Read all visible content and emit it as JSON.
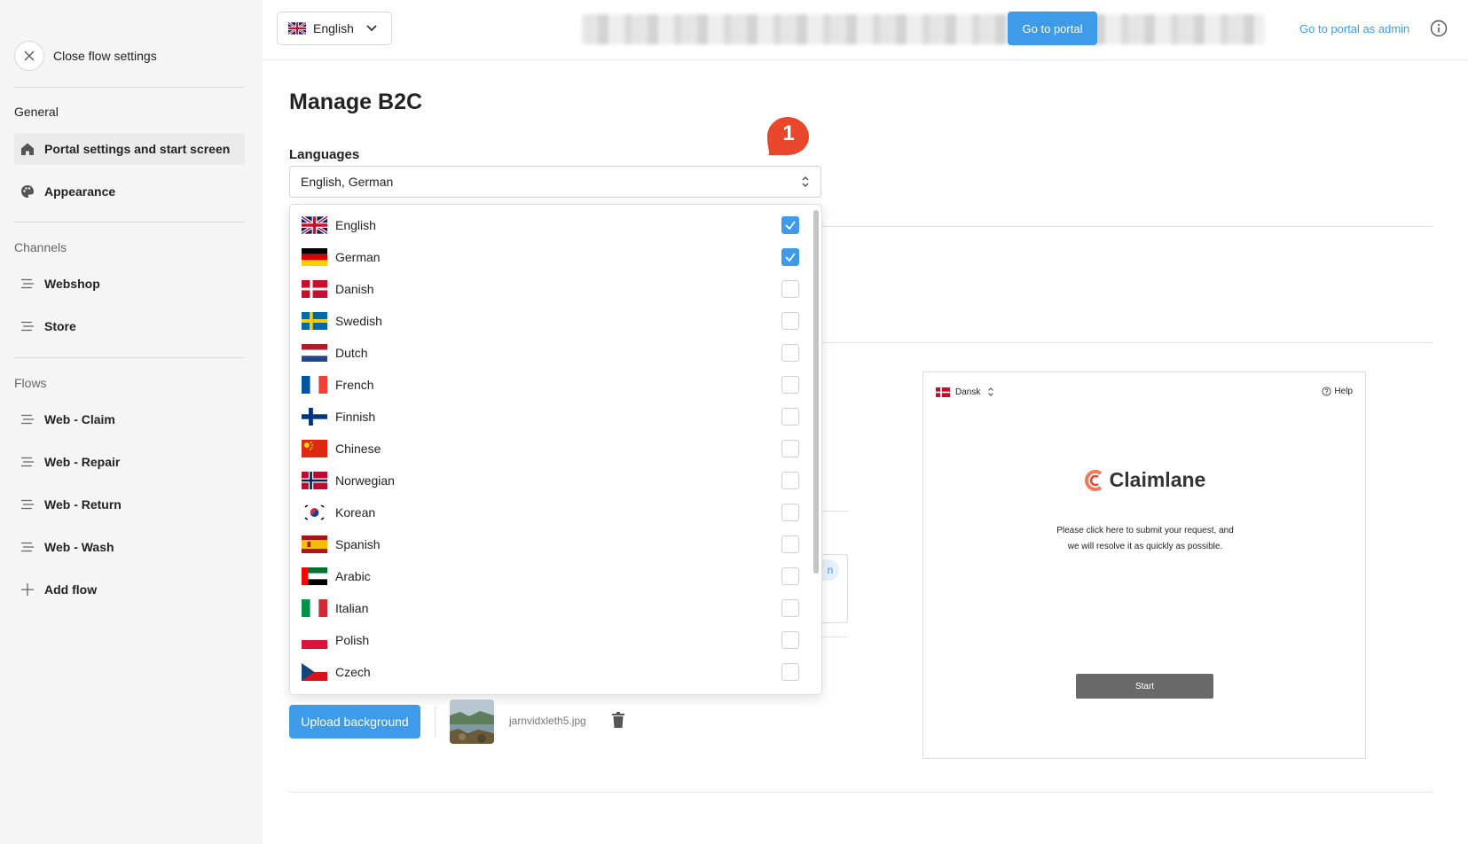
{
  "sidebar": {
    "close_label": "Close flow settings",
    "general_label": "General",
    "channels_label": "Channels",
    "flows_label": "Flows",
    "general_items": [
      {
        "label": "Portal settings and start screen",
        "icon": "home-icon",
        "active": true
      },
      {
        "label": "Appearance",
        "icon": "palette-icon",
        "active": false
      }
    ],
    "channel_items": [
      {
        "label": "Webshop",
        "icon": "flow-icon"
      },
      {
        "label": "Store",
        "icon": "flow-icon"
      }
    ],
    "flow_items": [
      {
        "label": "Web - Claim",
        "icon": "flow-icon"
      },
      {
        "label": "Web - Repair",
        "icon": "flow-icon"
      },
      {
        "label": "Web - Return",
        "icon": "flow-icon"
      },
      {
        "label": "Web - Wash",
        "icon": "flow-icon"
      }
    ],
    "add_flow_label": "Add flow"
  },
  "topbar": {
    "language": "English",
    "portal_button": "Go to portal",
    "admin_link": "Go to portal as admin"
  },
  "main": {
    "title": "Manage B2C",
    "languages_label": "Languages",
    "languages_value": "English, German",
    "badge_number": "1",
    "options": [
      {
        "name": "English",
        "flag": "gb",
        "checked": true
      },
      {
        "name": "German",
        "flag": "de",
        "checked": true
      },
      {
        "name": "Danish",
        "flag": "dk",
        "checked": false
      },
      {
        "name": "Swedish",
        "flag": "se",
        "checked": false
      },
      {
        "name": "Dutch",
        "flag": "nl",
        "checked": false
      },
      {
        "name": "French",
        "flag": "fr",
        "checked": false
      },
      {
        "name": "Finnish",
        "flag": "fi",
        "checked": false
      },
      {
        "name": "Chinese",
        "flag": "cn",
        "checked": false
      },
      {
        "name": "Norwegian",
        "flag": "no",
        "checked": false
      },
      {
        "name": "Korean",
        "flag": "kr",
        "checked": false
      },
      {
        "name": "Spanish",
        "flag": "es",
        "checked": false
      },
      {
        "name": "Arabic",
        "flag": "ae",
        "checked": false
      },
      {
        "name": "Italian",
        "flag": "it",
        "checked": false
      },
      {
        "name": "Polish",
        "flag": "pl",
        "checked": false
      },
      {
        "name": "Czech",
        "flag": "cz",
        "checked": false
      }
    ],
    "upload_button": "Upload background",
    "file_name": "jarnvidxleth5.jpg",
    "stub_text": "n"
  },
  "preview": {
    "language": "Dansk",
    "help": "Help",
    "brand": "Claimlane",
    "text": "Please click here to submit your request, and we will resolve it as quickly as possible.",
    "start_button": "Start"
  },
  "colors": {
    "accent": "#3d9be9",
    "badge": "#e8472b",
    "sidebar_bg": "#f5f5f5"
  }
}
